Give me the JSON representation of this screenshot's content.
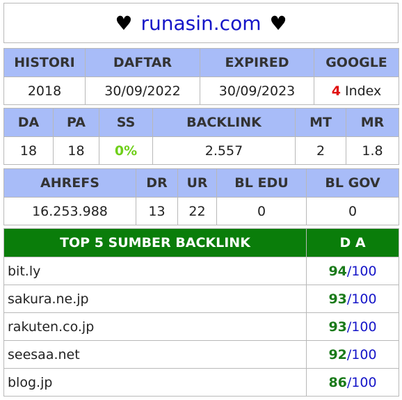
{
  "title": {
    "prefix_heart": "♥",
    "domain": "runasin.com",
    "suffix_heart": "♥"
  },
  "table1": {
    "headers": [
      "HISTORI",
      "DAFTAR",
      "EXPIRED",
      "GOOGLE"
    ],
    "histori": "2018",
    "daftar": "30/09/2022",
    "expired": "30/09/2023",
    "google_count": "4",
    "google_label": " Index"
  },
  "table2": {
    "headers": [
      "DA",
      "PA",
      "SS",
      "BACKLINK",
      "MT",
      "MR"
    ],
    "da": "18",
    "pa": "18",
    "ss": "0%",
    "backlink": "2.557",
    "mt": "2",
    "mr": "1.8"
  },
  "table3": {
    "headers": [
      "AHREFS",
      "DR",
      "UR",
      "BL EDU",
      "BL GOV"
    ],
    "ahrefs": "16.253.988",
    "dr": "13",
    "ur": "22",
    "bl_edu": "0",
    "bl_gov": "0"
  },
  "table4": {
    "header_source": "TOP 5 SUMBER BACKLINK",
    "header_da": "D A",
    "rows": [
      {
        "source": "bit.ly",
        "score": "94",
        "max": "/100"
      },
      {
        "source": "sakura.ne.jp",
        "score": "93",
        "max": "/100"
      },
      {
        "source": "rakuten.co.jp",
        "score": "93",
        "max": "/100"
      },
      {
        "source": "seesaa.net",
        "score": "92",
        "max": "/100"
      },
      {
        "source": "blog.jp",
        "score": "86",
        "max": "/100"
      }
    ]
  },
  "colors": {
    "header_blue": "#a8bcf8",
    "header_green": "#0a7d0a",
    "domain_blue": "#1515c8",
    "ss_green": "#6fcf1a",
    "google_red": "#e01010"
  }
}
